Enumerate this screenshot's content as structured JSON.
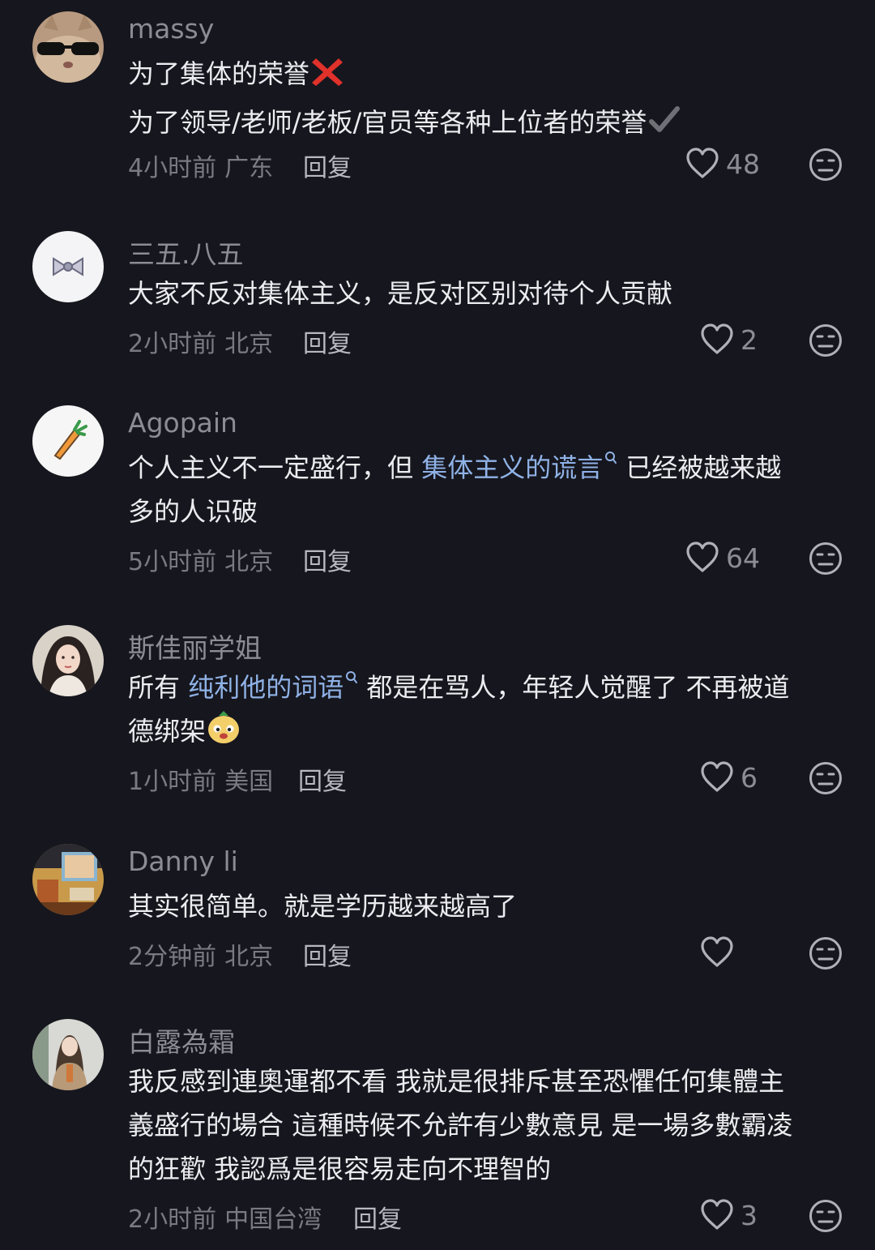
{
  "comments": [
    {
      "username": "massy",
      "lines": [
        "为了集体的荣誉",
        "为了领导/老师/老板/官员等各种上位者的荣誉"
      ],
      "time": "4小时前",
      "location": "广东",
      "reply_label": "回复",
      "likes": "48"
    },
    {
      "username": "三五.八五",
      "lines": [
        "大家不反对集体主义，是反对区别对待个人贡献"
      ],
      "time": "2小时前",
      "location": "北京",
      "reply_label": "回复",
      "likes": "2"
    },
    {
      "username": "Agopain",
      "line1_prefix": "个人主义不一定盛行，但 ",
      "keyword": "集体主义的谎言",
      "line1_suffix": " 已经被越来越",
      "line2": "多的人识破",
      "time": "5小时前",
      "location": "北京",
      "reply_label": "回复",
      "likes": "64"
    },
    {
      "username": "斯佳丽学姐",
      "line1_prefix": "所有 ",
      "keyword": "纯利他的词语",
      "line1_suffix": " 都是在骂人，年轻人觉醒了 不再被道",
      "line2": "德绑架",
      "time": "1小时前",
      "location": "美国",
      "reply_label": "回复",
      "likes": "6"
    },
    {
      "username": "Danny li",
      "lines": [
        "其实很简单。就是学历越来越高了"
      ],
      "time": "2分钟前",
      "location": "北京",
      "reply_label": "回复",
      "likes": ""
    },
    {
      "username": "白露為霜",
      "lines": [
        "我反感到連奧運都不看 我就是很排斥甚至恐懼任何集體主",
        "義盛行的場合 這種時候不允許有少數意見 是一場多數霸凌",
        "的狂歡 我認爲是很容易走向不理智的"
      ],
      "time": "2小时前",
      "location": "中国台湾",
      "reply_label": "回复",
      "likes": "3"
    }
  ],
  "icons": {
    "like": "heart-outline-icon",
    "dislike": "meh-face-icon",
    "cross": "red-cross-emoji",
    "check": "check-mark-emoji",
    "keyword_search": "search-icon",
    "emoji": "dog-face-emoji"
  },
  "colors": {
    "background": "#16161e",
    "keyword": "#8fb2e6",
    "cross": "#e0312b"
  }
}
